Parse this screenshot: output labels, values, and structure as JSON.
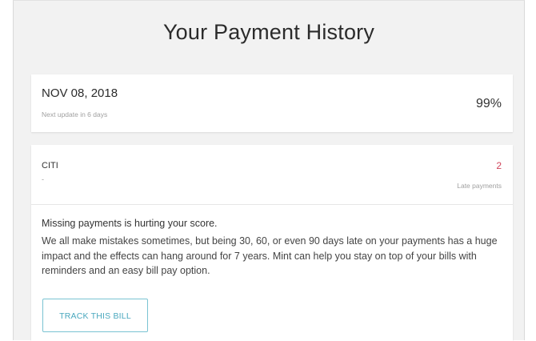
{
  "page": {
    "title": "Your Payment History"
  },
  "summary": {
    "date": "NOV 08, 2018",
    "next_update": "Next update in 6 days",
    "percentage": "99%"
  },
  "account": {
    "name": "CITI",
    "sub": "-",
    "late_payments_count": "2",
    "late_payments_label": "Late payments",
    "message_heading": "Missing payments is hurting your score.",
    "message_body": "We all make mistakes sometimes, but being 30, 60, or even 90 days late on your payments has a huge impact and the effects can hang around for 7 years. Mint can help you stay on top of your bills with reminders and an easy bill pay option.",
    "track_button_label": "TRACK THIS BILL"
  },
  "colors": {
    "late_count": "#d0455b",
    "button_accent": "#4aa8be"
  }
}
